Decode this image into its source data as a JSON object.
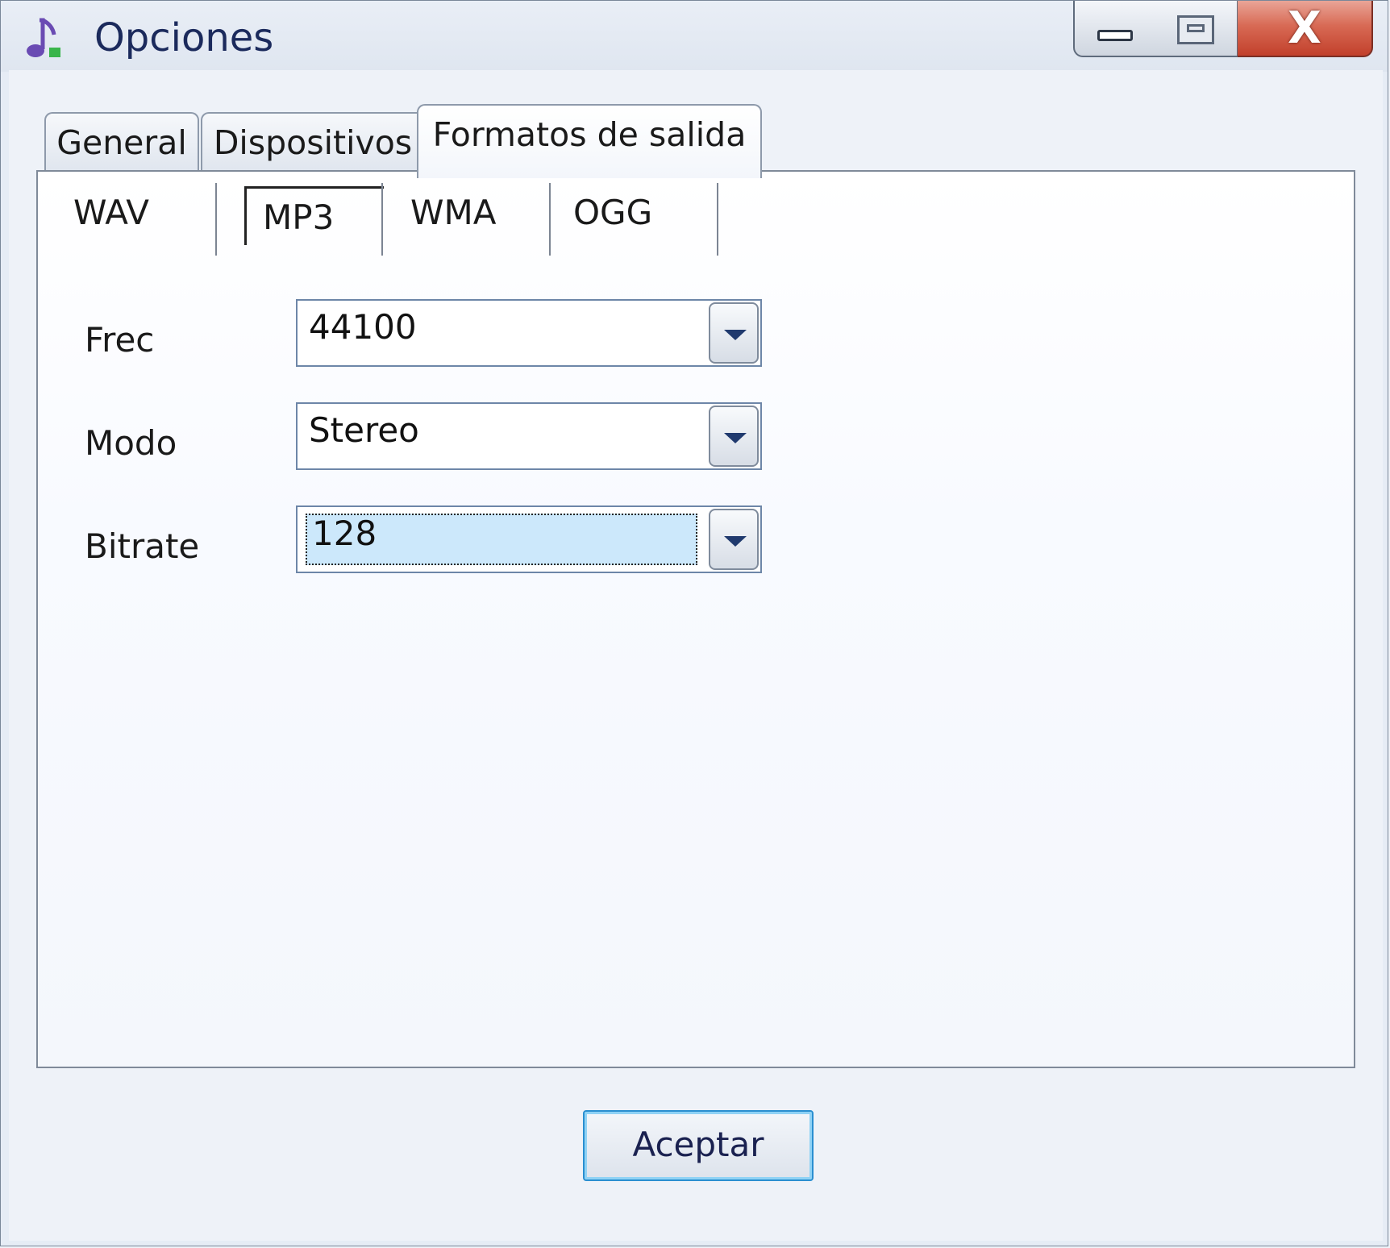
{
  "window": {
    "title": "Opciones",
    "icon": "music-note-icon",
    "controls": [
      "minimize-icon",
      "maximize-icon",
      "close-icon"
    ]
  },
  "tabs": [
    {
      "label": "General",
      "active": false
    },
    {
      "label": "Dispositivos",
      "active": false
    },
    {
      "label": "Formatos de salida",
      "active": true
    }
  ],
  "subtabs": [
    {
      "label": "WAV",
      "active": false
    },
    {
      "label": "MP3",
      "active": true
    },
    {
      "label": "WMA",
      "active": false
    },
    {
      "label": "OGG",
      "active": false
    }
  ],
  "fields": {
    "frec": {
      "label": "Frec",
      "value": "44100"
    },
    "modo": {
      "label": "Modo",
      "value": "Stereo"
    },
    "bitrate": {
      "label": "Bitrate",
      "value": "128",
      "focused": true
    }
  },
  "footer": {
    "ok_label": "Aceptar"
  },
  "colors": {
    "close_button": "#d0533f",
    "focus_highlight": "#cce8fb",
    "default_button_border": "#2a8fd0"
  }
}
